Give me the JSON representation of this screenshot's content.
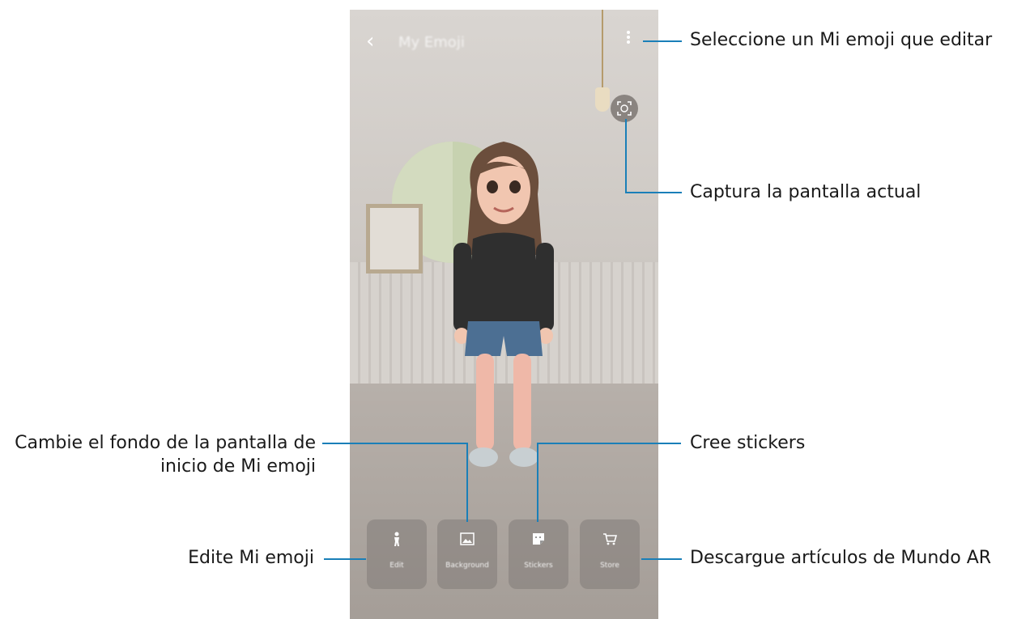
{
  "phone": {
    "app_title": "My Emoji",
    "back_icon": "chevron-left-icon",
    "menu_icon": "more-vertical-icon",
    "capture_icon": "face-capture-icon"
  },
  "tiles": [
    {
      "label": "Edit",
      "icon": "person-icon"
    },
    {
      "label": "Background",
      "icon": "image-icon"
    },
    {
      "label": "Stickers",
      "icon": "sticker-icon"
    },
    {
      "label": "Store",
      "icon": "cart-icon"
    }
  ],
  "callouts": {
    "menu": "Seleccione un Mi emoji que editar",
    "capture": "Captura la pantalla actual",
    "background_line1": "Cambie el fondo de la pantalla de",
    "background_line2": "inicio de Mi emoji",
    "stickers": "Cree stickers",
    "edit": "Edite Mi emoji",
    "store": "Descargue artículos de Mundo AR"
  },
  "colors": {
    "leader_line": "#1a7fb8"
  }
}
